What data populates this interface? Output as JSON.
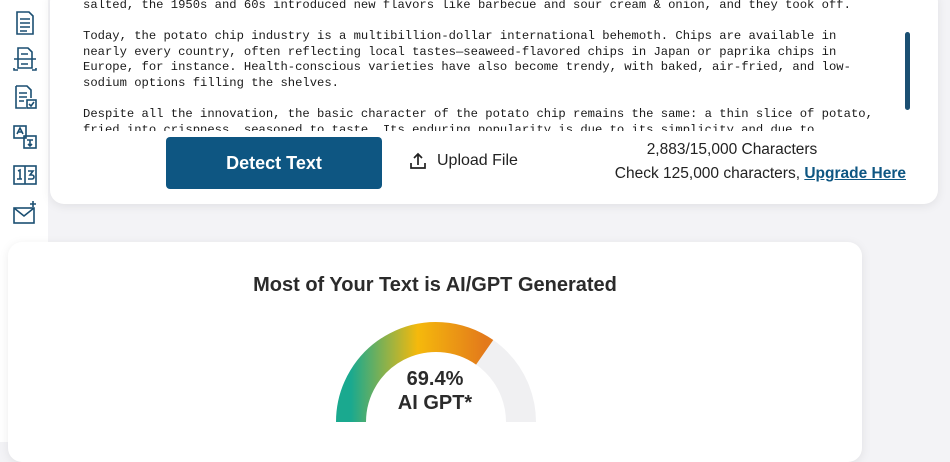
{
  "sidebar": {
    "items": [
      {
        "icon": "document-list-icon"
      },
      {
        "icon": "document-scan-icon"
      },
      {
        "icon": "document-check-icon"
      },
      {
        "icon": "translate-icon"
      },
      {
        "icon": "word-count-icon"
      },
      {
        "icon": "mail-sparkle-icon"
      }
    ]
  },
  "editor": {
    "paragraphs": [
      "salted, the 1950s and 60s introduced new flavors like barbecue and sour cream & onion, and they took off.",
      "Today, the potato chip industry is a multibillion-dollar international behemoth.  Chips are available in nearly every country, often reflecting local tastes—seaweed-flavored chips in Japan or paprika chips in Europe, for instance.  Health-conscious varieties have also become trendy, with baked, air-fried, and low-sodium options filling the shelves.",
      "Despite all the innovation, the basic character of the potato chip remains the same: a thin slice of potato, fried into crispness, seasoned to taste.  Its enduring popularity is due to its simplicity and due to"
    ]
  },
  "actions": {
    "detect_label": "Detect Text",
    "upload_label": "Upload File"
  },
  "counter": {
    "characters_text": "2,883/15,000 Characters",
    "upgrade_prefix": "Check 125,000 characters, ",
    "upgrade_link": "Upgrade Here"
  },
  "result": {
    "title": "Most of Your Text is AI/GPT Generated",
    "percent_text": "69.4%",
    "percent_value": 69.4,
    "label": "AI GPT*"
  },
  "colors": {
    "accent": "#0e5682",
    "gauge_start": "#1aa98f",
    "gauge_mid": "#f5b90c",
    "gauge_end": "#e37a1b",
    "gauge_track": "#f0f0f2"
  }
}
